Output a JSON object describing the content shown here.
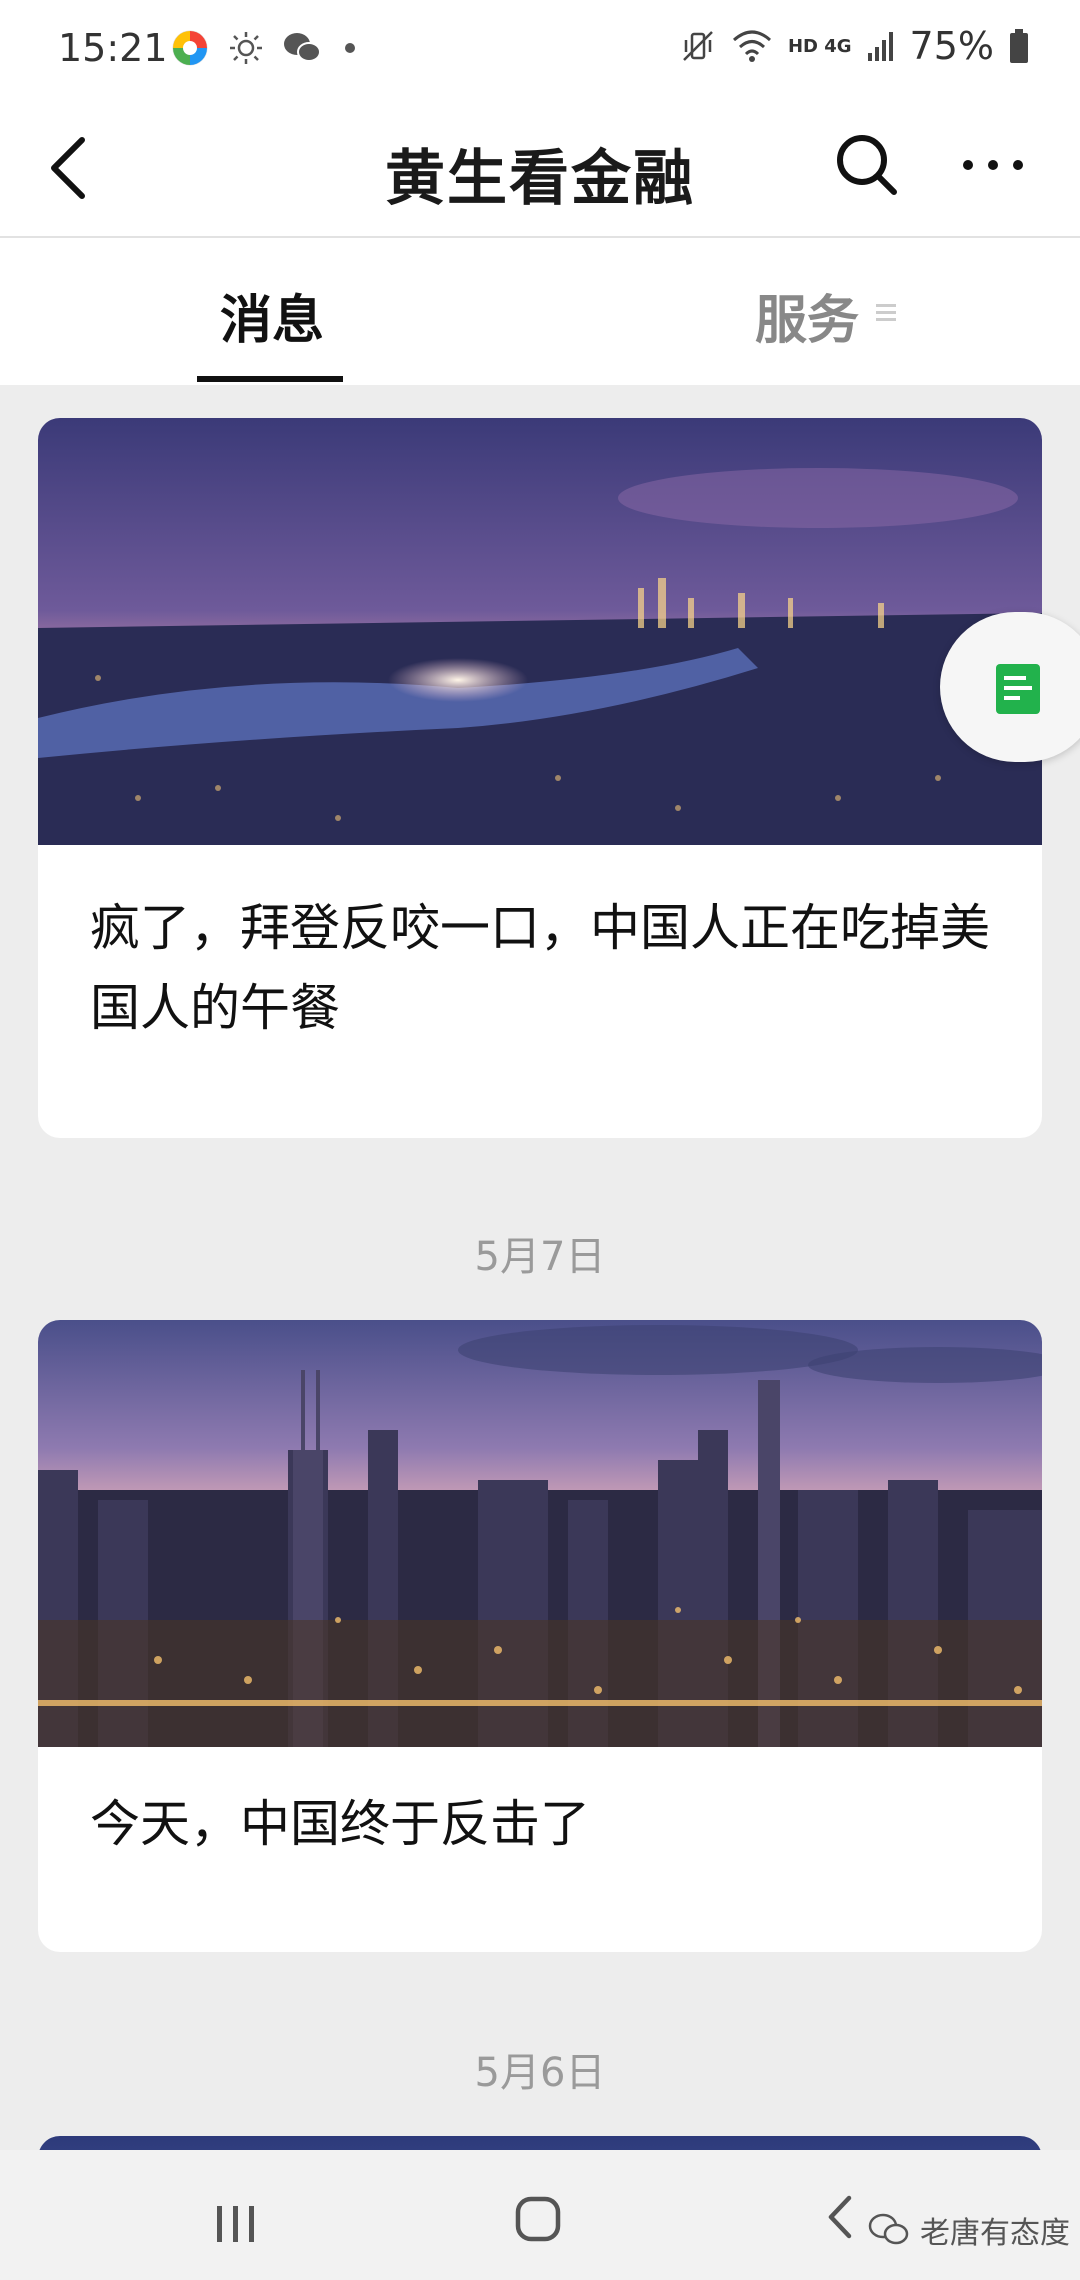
{
  "status_bar": {
    "time": "15:21",
    "battery": "75%",
    "network": "HD 4G",
    "icons": [
      "app-logo-icon",
      "brightness-icon",
      "wechat-icon",
      "dot-icon",
      "mute-vibrate-icon",
      "wifi-icon",
      "signal-icon",
      "battery-icon"
    ]
  },
  "header": {
    "title": "黄生看金融",
    "icons": [
      "back-arrow-icon",
      "search-icon",
      "more-icon"
    ]
  },
  "tabs": [
    {
      "label": "消息",
      "active": true
    },
    {
      "label": "服务",
      "active": false
    }
  ],
  "articles": [
    {
      "title": "疯了，拜登反咬一口，中国人正在吃掉美国人的午餐"
    },
    {
      "title": "今天，中国终于反击了"
    }
  ],
  "dates": [
    "5月7日",
    "5月6日"
  ],
  "watermark": "老唐有态度",
  "colors": {
    "accent_green": "#22b24c",
    "background": "#ededed"
  }
}
